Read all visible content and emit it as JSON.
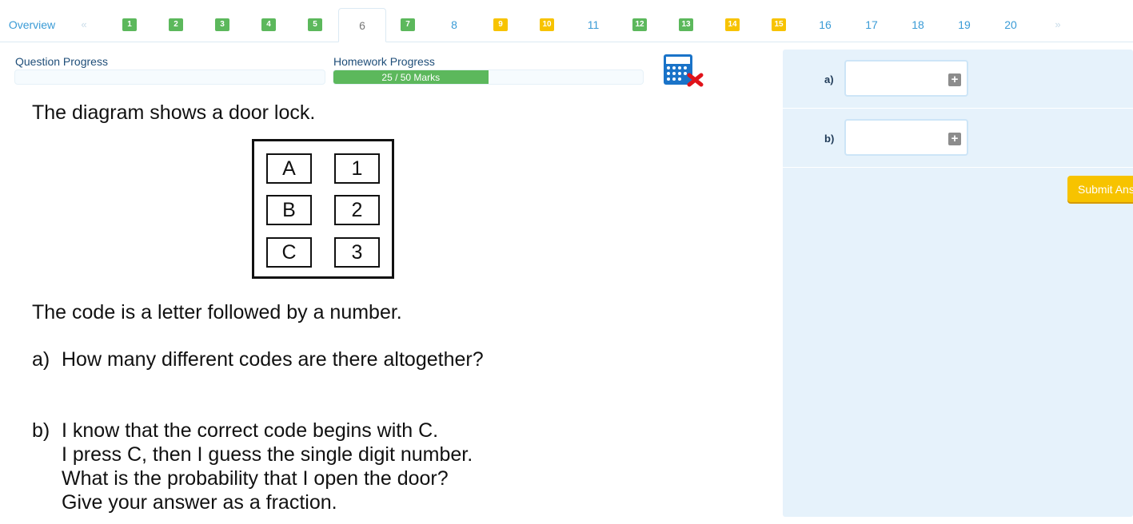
{
  "nav": {
    "overview": "Overview",
    "prev_arrow": "«",
    "next_arrow": "»",
    "items": [
      {
        "label": "1",
        "status": "green"
      },
      {
        "label": "2",
        "status": "green"
      },
      {
        "label": "3",
        "status": "green"
      },
      {
        "label": "4",
        "status": "green"
      },
      {
        "label": "5",
        "status": "green"
      },
      {
        "label": "6",
        "status": "current"
      },
      {
        "label": "7",
        "status": "green"
      },
      {
        "label": "8",
        "status": "none"
      },
      {
        "label": "9",
        "status": "yellow"
      },
      {
        "label": "10",
        "status": "yellow"
      },
      {
        "label": "11",
        "status": "none"
      },
      {
        "label": "12",
        "status": "green"
      },
      {
        "label": "13",
        "status": "green"
      },
      {
        "label": "14",
        "status": "yellow"
      },
      {
        "label": "15",
        "status": "yellow"
      },
      {
        "label": "16",
        "status": "none"
      },
      {
        "label": "17",
        "status": "none"
      },
      {
        "label": "18",
        "status": "none"
      },
      {
        "label": "19",
        "status": "none"
      },
      {
        "label": "20",
        "status": "none"
      }
    ]
  },
  "progress": {
    "question_label": "Question Progress",
    "question_fraction": 0,
    "homework_label": "Homework Progress",
    "homework_text": "25 / 50 Marks",
    "homework_fraction": 0.5
  },
  "question": {
    "intro": "The diagram shows a door lock.",
    "lock_letters": [
      "A",
      "B",
      "C"
    ],
    "lock_numbers": [
      "1",
      "2",
      "3"
    ],
    "code_text": "The code is a letter followed by a number.",
    "part_a_letter": "a)",
    "part_a_text": "How many different codes are there altogether?",
    "part_b_letter": "b)",
    "part_b_lines": [
      "I know that the correct code begins with C.",
      "I press C, then I guess the single digit number.",
      "What is the probability that I open the door?",
      "Give your answer as a fraction."
    ]
  },
  "answers": {
    "a_label": "a)",
    "b_label": "b)",
    "a_value": "",
    "b_value": "",
    "plus_glyph": "+",
    "submit_label": "Submit Answers"
  },
  "colors": {
    "green": "#5cb85c",
    "yellow": "#f7c300",
    "link_blue": "#3a9bd6",
    "panel_bg": "#e6f2fb"
  },
  "icons": {
    "calculator": "calculator-disabled-icon"
  }
}
